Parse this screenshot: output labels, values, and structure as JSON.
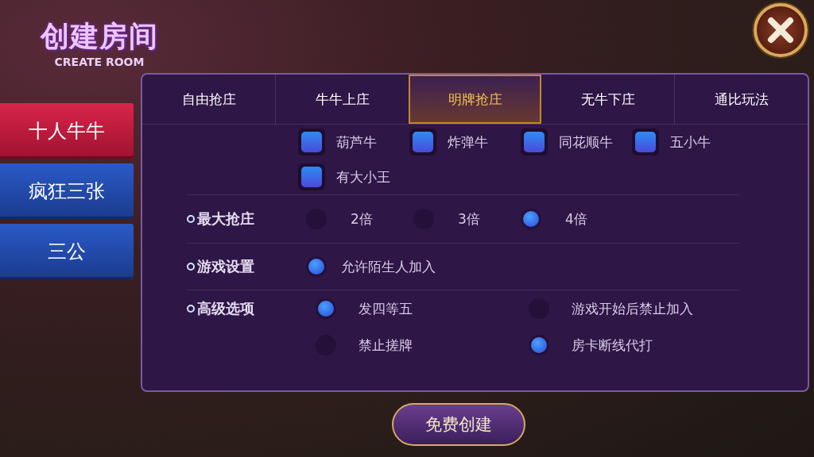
{
  "header": {
    "title": "创建房间",
    "subtitle": "CREATE ROOM"
  },
  "game_tabs": [
    {
      "label": "十人牛牛",
      "selected": true
    },
    {
      "label": "疯狂三张",
      "selected": false
    },
    {
      "label": "三公",
      "selected": false
    }
  ],
  "mode_tabs": [
    {
      "label": "自由抢庄",
      "selected": false
    },
    {
      "label": "牛牛上庄",
      "selected": false
    },
    {
      "label": "明牌抢庄",
      "selected": true
    },
    {
      "label": "无牛下庄",
      "selected": false
    },
    {
      "label": "通比玩法",
      "selected": false
    }
  ],
  "sections": [
    {
      "kind": "checkbox",
      "options": [
        {
          "label": "葫芦牛",
          "checked": true
        },
        {
          "label": "炸弹牛",
          "checked": true
        },
        {
          "label": "同花顺牛",
          "checked": true
        },
        {
          "label": "五小牛",
          "checked": true
        },
        {
          "label": "有大小王",
          "checked": true
        }
      ]
    },
    {
      "kind": "radio",
      "label": "最大抢庄",
      "options": [
        {
          "label": "2倍",
          "selected": false
        },
        {
          "label": "3倍",
          "selected": false
        },
        {
          "label": "4倍",
          "selected": true
        }
      ]
    },
    {
      "kind": "toggle",
      "label": "游戏设置",
      "options": [
        {
          "label": "允许陌生人加入",
          "checked": true
        }
      ]
    },
    {
      "kind": "toggle-wide",
      "label": "高级选项",
      "options": [
        {
          "label": "发四等五",
          "checked": true
        },
        {
          "label": "游戏开始后禁止加入",
          "checked": false
        },
        {
          "label": "禁止搓牌",
          "checked": false
        },
        {
          "label": "房卡断线代打",
          "checked": true
        }
      ]
    }
  ],
  "create_button": "免费创建"
}
